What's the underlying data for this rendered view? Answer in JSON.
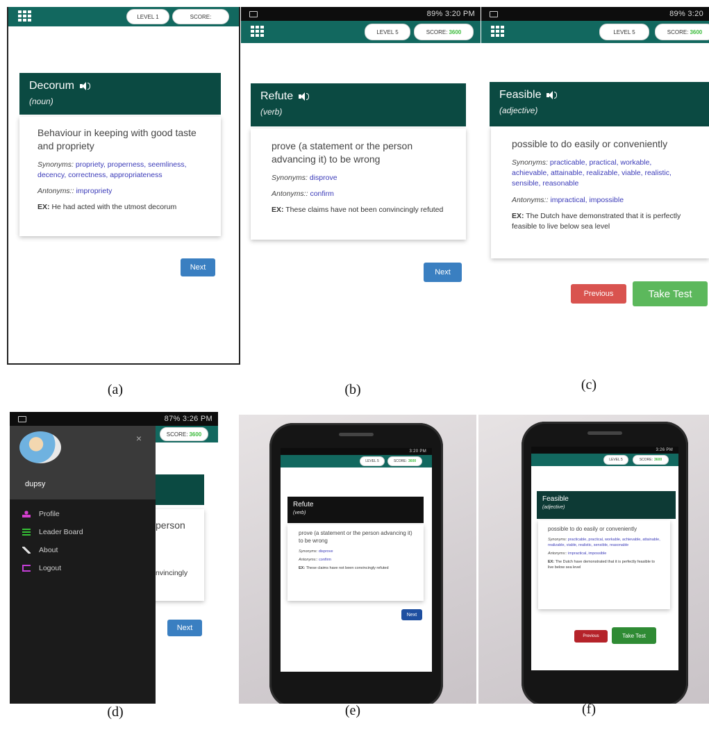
{
  "captions": [
    "(a)",
    "(b)",
    "(c)",
    "(d)",
    "(e)",
    "(f)"
  ],
  "status": {
    "b": "89% 3:20 PM",
    "c": "89% 3:20",
    "d": "87% 3:26 PM",
    "e": "3:20 PM",
    "f": "3:26 PM"
  },
  "header": {
    "level1": "LEVEL 1",
    "level5": "LEVEL 5",
    "score_label": "SCORE:",
    "score_value": "3600"
  },
  "cards": {
    "decorum": {
      "word": "Decorum",
      "pos": "(noun)",
      "definition": "Behaviour in keeping with good taste and propriety",
      "syn_label": "Synonyms:",
      "synonyms": "propriety, properness, seemliness, decency, correctness, appropriateness",
      "ant_label": "Antonyms::",
      "antonyms": "impropriety",
      "ex_label": "EX:",
      "example": "He had acted with the utmost decorum"
    },
    "refute": {
      "word": "Refute",
      "pos": "(verb)",
      "definition": "prove (a statement or the person advancing it) to be wrong",
      "syn_label": "Synonyms:",
      "synonyms": "disprove",
      "ant_label": "Antonyms::",
      "antonyms": "confirm",
      "ex_label": "EX:",
      "example": "These claims have not been convincingly refuted"
    },
    "feasible": {
      "word": "Feasible",
      "pos": "(adjective)",
      "definition": "possible to do easily or conveniently",
      "syn_label": "Synonyms:",
      "synonyms": "practicable, practical, workable, achievable, attainable, realizable, viable, realistic, sensible, reasonable",
      "ant_label": "Antonyms::",
      "antonyms": "impractical, impossible",
      "ex_label": "EX:",
      "example": "The Dutch have demonstrated that it is perfectly feasible to live below sea level"
    }
  },
  "buttons": {
    "next": "Next",
    "previous": "Previous",
    "take_test": "Take Test"
  },
  "drawer": {
    "username": "dupsy",
    "close": "×",
    "items": [
      {
        "label": "Profile",
        "icon": "person-icon",
        "color": "#d63fd0"
      },
      {
        "label": "Leader Board",
        "icon": "list-icon",
        "color": "#36c436"
      },
      {
        "label": "About",
        "icon": "wrench-icon",
        "color": "#e0e0e0"
      },
      {
        "label": "Logout",
        "icon": "logout-icon",
        "color": "#c43fd6"
      }
    ],
    "peek_text_1": "person",
    "peek_text_2": "nvincingly"
  },
  "colors": {
    "appbar": "#12685f",
    "card_head": "#0b4a42",
    "score_green": "#3cbb3c",
    "next_blue": "#3a7fc1",
    "prev_red": "#d9534f",
    "test_green": "#5cb85c"
  }
}
